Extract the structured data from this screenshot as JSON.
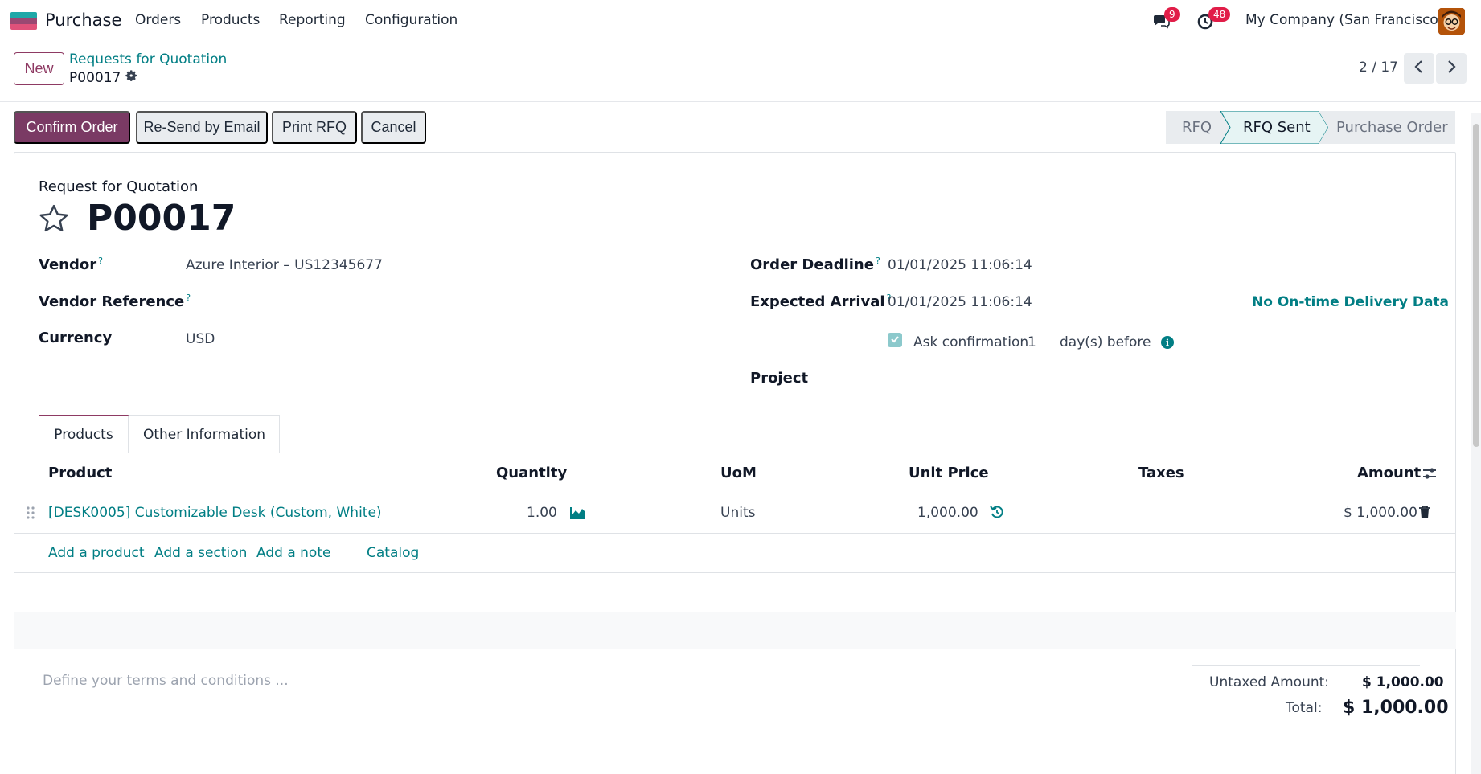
{
  "navbar": {
    "app_name": "Purchase",
    "menu": [
      "Orders",
      "Products",
      "Reporting",
      "Configuration"
    ],
    "messages_count": "9",
    "activities_count": "48",
    "company": "My Company (San Francisco)"
  },
  "control": {
    "new_label": "New",
    "breadcrumb": "Requests for Quotation",
    "record": "P00017",
    "pager": "2 / 17"
  },
  "actions": {
    "confirm": "Confirm Order",
    "resend": "Re-Send by Email",
    "print": "Print RFQ",
    "cancel": "Cancel"
  },
  "statusbar": {
    "steps": [
      "RFQ",
      "RFQ Sent",
      "Purchase Order"
    ],
    "current": "RFQ Sent"
  },
  "form": {
    "subtitle": "Request for Quotation",
    "title": "P00017",
    "vendor_label": "Vendor",
    "vendor_value": "Azure Interior – US12345677",
    "vendor_ref_label": "Vendor Reference",
    "currency_label": "Currency",
    "currency_value": "USD",
    "deadline_label": "Order Deadline",
    "deadline_value": "01/01/2025 11:06:14",
    "arrival_label": "Expected Arrival",
    "arrival_value": "01/01/2025 11:06:14",
    "ontime_link": "No On-time Delivery Data",
    "ask_confirmation": "Ask confirmation",
    "ask_days": "1",
    "days_before": "day(s) before",
    "project_label": "Project",
    "help_mark": "?"
  },
  "tabs": [
    "Products",
    "Other Information"
  ],
  "table": {
    "headers": {
      "product": "Product",
      "quantity": "Quantity",
      "uom": "UoM",
      "unit_price": "Unit Price",
      "taxes": "Taxes",
      "amount": "Amount"
    },
    "row": {
      "product": "[DESK0005] Customizable Desk (Custom, White)",
      "quantity": "1.00",
      "uom": "Units",
      "unit_price": "1,000.00",
      "amount": "$ 1,000.00"
    },
    "add_product": "Add a product",
    "add_section": "Add a section",
    "add_note": "Add a note",
    "catalog": "Catalog"
  },
  "footer": {
    "terms_placeholder": "Define your terms and conditions ...",
    "untaxed_label": "Untaxed Amount:",
    "untaxed_value": "$ 1,000.00",
    "total_label": "Total:",
    "total_value": "$ 1,000.00"
  },
  "colors": {
    "primary": "#7a3a64",
    "link": "#017e84",
    "badge": "#e11d48"
  }
}
